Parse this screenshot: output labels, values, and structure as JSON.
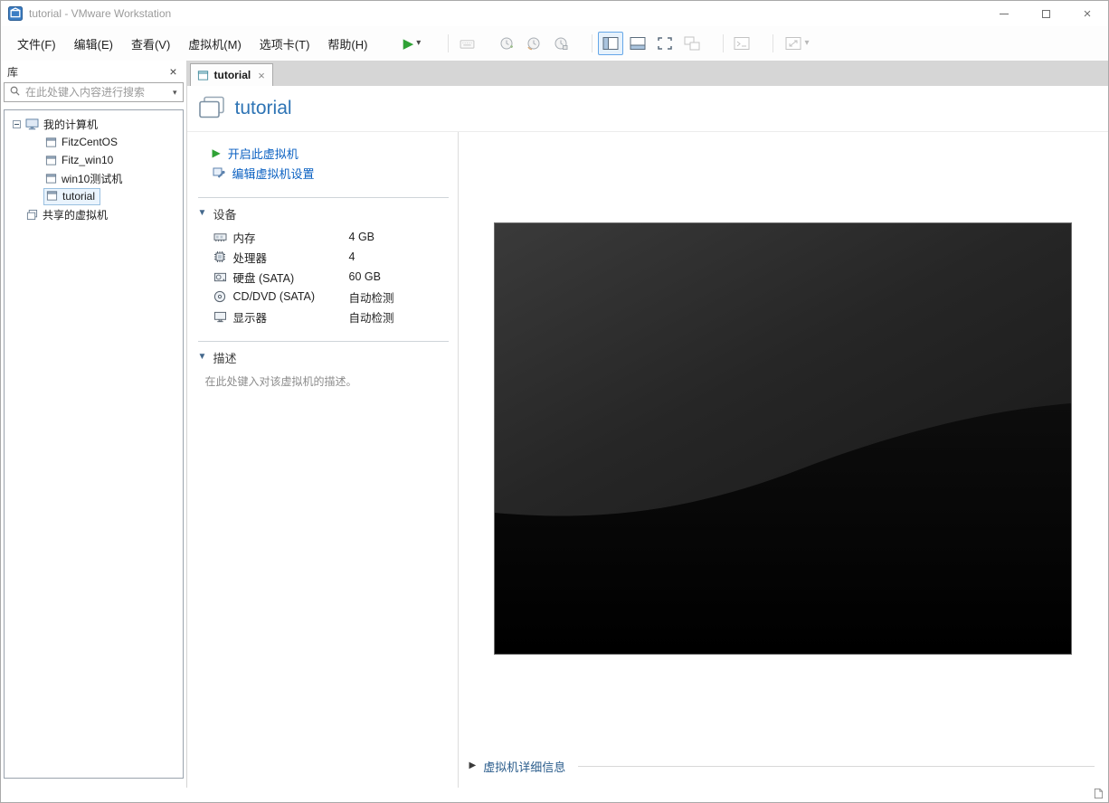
{
  "window": {
    "title": "tutorial - VMware Workstation",
    "controls": {
      "close": "×"
    }
  },
  "menubar": {
    "items": [
      "文件(F)",
      "编辑(E)",
      "查看(V)",
      "虚拟机(M)",
      "选项卡(T)",
      "帮助(H)"
    ]
  },
  "toolbar": {
    "buttons": [
      {
        "name": "power-on",
        "enabled": true
      },
      {
        "name": "send-ctrl-alt-del",
        "enabled": false
      },
      {
        "name": "take-snapshot",
        "enabled": false
      },
      {
        "name": "revert-snapshot",
        "enabled": false
      },
      {
        "name": "snapshot-manager",
        "enabled": false
      },
      {
        "name": "show-library",
        "enabled": true,
        "active": true
      },
      {
        "name": "show-thumbnail-bar",
        "enabled": true
      },
      {
        "name": "full-screen",
        "enabled": true
      },
      {
        "name": "unity-mode",
        "enabled": false
      },
      {
        "name": "console-view",
        "enabled": false
      },
      {
        "name": "free-stretch",
        "enabled": false
      }
    ]
  },
  "sidebar": {
    "title": "库",
    "close_glyph": "×",
    "search": {
      "placeholder": "在此处键入内容进行搜索"
    },
    "tree": {
      "items": [
        {
          "label": "我的计算机"
        },
        {
          "label": "FitzCentOS"
        },
        {
          "label": "Fitz_win10"
        },
        {
          "label": "win10测试机"
        },
        {
          "label": "tutorial",
          "selected": true
        },
        {
          "label": "共享的虚拟机"
        }
      ]
    }
  },
  "tabbar": {
    "tabs": [
      {
        "label": "tutorial",
        "close_glyph": "×",
        "active": true
      }
    ]
  },
  "vm": {
    "name": "tutorial",
    "commands": [
      {
        "label": "开启此虚拟机"
      },
      {
        "label": "编辑虚拟机设置"
      }
    ],
    "devices": {
      "title": "设备",
      "rows": [
        {
          "label": "内存",
          "value": "4 GB"
        },
        {
          "label": "处理器",
          "value": "4"
        },
        {
          "label": "硬盘 (SATA)",
          "value": "60 GB"
        },
        {
          "label": "CD/DVD (SATA)",
          "value": "自动检测"
        },
        {
          "label": "显示器",
          "value": "自动检测"
        }
      ]
    },
    "description": {
      "title": "描述",
      "placeholder": "在此处键入对该虚拟机的描述。"
    },
    "details": {
      "title": "虚拟机详细信息",
      "collapsed_glyph": "▶"
    }
  },
  "glyphs": {
    "play": "▶",
    "caret_down": "▾",
    "section_expanded": "▼",
    "minimize": "–"
  },
  "colors": {
    "link_blue": "#0b61c2",
    "vm_name_blue": "#2e74b5",
    "play_green": "#2fa235",
    "tab_strip": "#d6d6d6"
  }
}
